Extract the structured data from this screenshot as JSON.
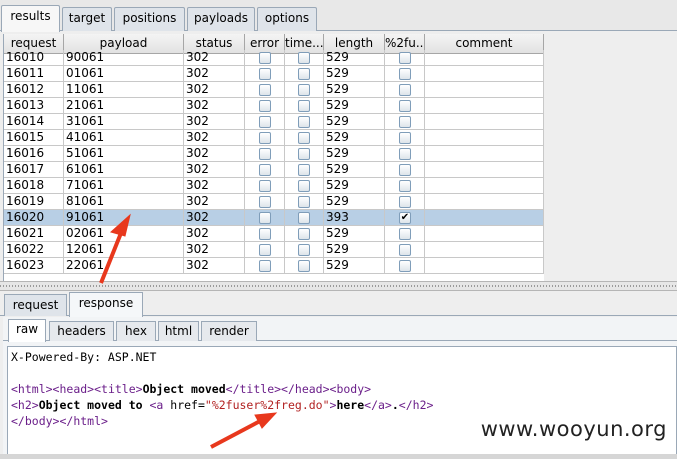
{
  "top_tabs": [
    "results",
    "target",
    "positions",
    "payloads",
    "options"
  ],
  "active_top_tab": 0,
  "columns": [
    "request",
    "payload",
    "status",
    "error",
    "time...",
    "length",
    "%2fu...",
    "comment"
  ],
  "rows": [
    {
      "request": "16010",
      "payload": "90061",
      "status": "302",
      "error": false,
      "timeout": false,
      "length": "529",
      "match": false,
      "selected": false
    },
    {
      "request": "16011",
      "payload": "01061",
      "status": "302",
      "error": false,
      "timeout": false,
      "length": "529",
      "match": false,
      "selected": false
    },
    {
      "request": "16012",
      "payload": "11061",
      "status": "302",
      "error": false,
      "timeout": false,
      "length": "529",
      "match": false,
      "selected": false
    },
    {
      "request": "16013",
      "payload": "21061",
      "status": "302",
      "error": false,
      "timeout": false,
      "length": "529",
      "match": false,
      "selected": false
    },
    {
      "request": "16014",
      "payload": "31061",
      "status": "302",
      "error": false,
      "timeout": false,
      "length": "529",
      "match": false,
      "selected": false
    },
    {
      "request": "16015",
      "payload": "41061",
      "status": "302",
      "error": false,
      "timeout": false,
      "length": "529",
      "match": false,
      "selected": false
    },
    {
      "request": "16016",
      "payload": "51061",
      "status": "302",
      "error": false,
      "timeout": false,
      "length": "529",
      "match": false,
      "selected": false
    },
    {
      "request": "16017",
      "payload": "61061",
      "status": "302",
      "error": false,
      "timeout": false,
      "length": "529",
      "match": false,
      "selected": false
    },
    {
      "request": "16018",
      "payload": "71061",
      "status": "302",
      "error": false,
      "timeout": false,
      "length": "529",
      "match": false,
      "selected": false
    },
    {
      "request": "16019",
      "payload": "81061",
      "status": "302",
      "error": false,
      "timeout": false,
      "length": "529",
      "match": false,
      "selected": false
    },
    {
      "request": "16020",
      "payload": "91061",
      "status": "302",
      "error": false,
      "timeout": false,
      "length": "393",
      "match": true,
      "selected": true
    },
    {
      "request": "16021",
      "payload": "02061",
      "status": "302",
      "error": false,
      "timeout": false,
      "length": "529",
      "match": false,
      "selected": false
    },
    {
      "request": "16022",
      "payload": "12061",
      "status": "302",
      "error": false,
      "timeout": false,
      "length": "529",
      "match": false,
      "selected": false
    },
    {
      "request": "16023",
      "payload": "22061",
      "status": "302",
      "error": false,
      "timeout": false,
      "length": "529",
      "match": false,
      "selected": false
    }
  ],
  "check_glyph": "✔",
  "detail_tabs": [
    "request",
    "response"
  ],
  "active_detail_tab": 1,
  "view_tabs": [
    "raw",
    "headers",
    "hex",
    "html",
    "render"
  ],
  "active_view_tab": 0,
  "response": {
    "header_line": "X-Powered-By: ASP.NET",
    "l1": {
      "o1": "<html>",
      "o2": "<head>",
      "o3": "<title>",
      "title": "Object moved",
      "c3": "</title>",
      "c2": "</head>",
      "o4": "<body>"
    },
    "l2": {
      "o5": "<h2>",
      "text1": "Object moved to ",
      "o6": "<a ",
      "attr": "href=",
      "val": "\"%2fuser%2freg.do\"",
      "o6e": ">",
      "text2": "here",
      "c6": "</a>",
      "dot": ".",
      "c5": "</h2>"
    },
    "l3": {
      "c4": "</body>",
      "c1": "</html>"
    }
  },
  "watermark": "www.wooyun.org",
  "colors": {
    "selected_row": "#b8cfe5",
    "arrow": "#e8381d",
    "tag": "#6b1f8a"
  }
}
